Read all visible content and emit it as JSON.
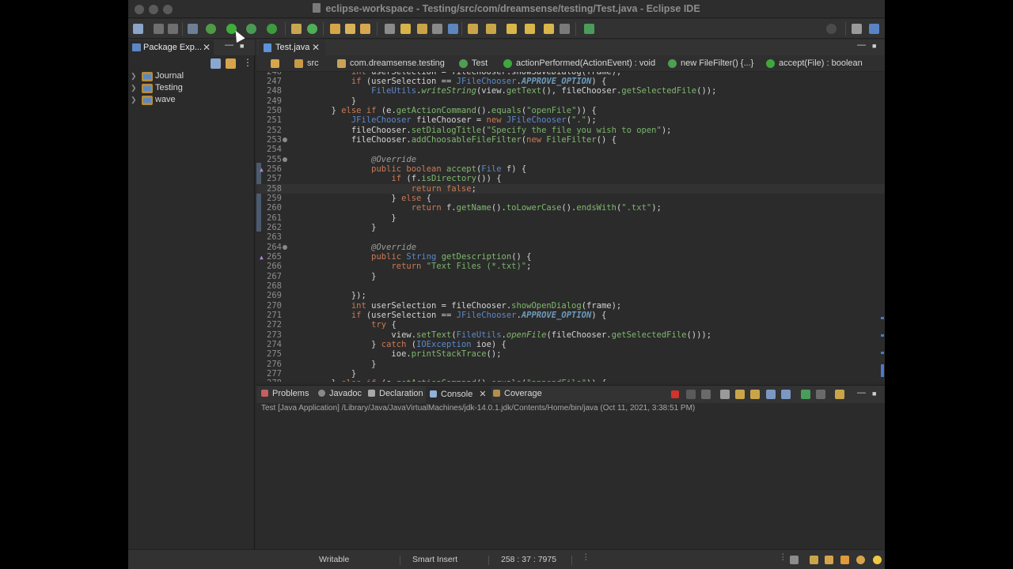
{
  "window": {
    "title": "eclipse-workspace - Testing/src/com/dreamsense/testing/Test.java - Eclipse IDE"
  },
  "colors": {
    "keyword": "#cc7a54",
    "type": "#5c89c9",
    "string": "#79b36b",
    "method": "#7fb86f",
    "field": "#6d9cbe",
    "annotation": "#9d9d9d",
    "background": "#2b2b2b"
  },
  "toolbar": {
    "icons": [
      "new-icon",
      "save-icon",
      "save-all-icon",
      "skip-breakpoints-icon",
      "debug-icon",
      "run-icon",
      "coverage-icon",
      "external-tools-icon",
      "new-java-project-icon",
      "new-package-icon",
      "new-class-icon",
      "open-type-icon",
      "search-icon",
      "perspective-java-icon",
      "perspective-debug-icon"
    ]
  },
  "package_explorer": {
    "tab_label": "Package Exp...",
    "projects": [
      {
        "name": "Journal"
      },
      {
        "name": "Testing"
      },
      {
        "name": "wave"
      }
    ]
  },
  "editor": {
    "tab_label": "Test.java",
    "breadcrumb": [
      "src",
      "com.dreamsense.testing",
      "Test",
      "actionPerformed(ActionEvent) : void",
      "new FileFilter() {...}",
      "accept(File) : boolean"
    ],
    "current_line": "258"
  },
  "console": {
    "tabs": [
      {
        "label": "Problems"
      },
      {
        "label": "Javadoc"
      },
      {
        "label": "Declaration"
      },
      {
        "label": "Console"
      },
      {
        "label": "Coverage"
      }
    ],
    "description": "Test [Java Application] /Library/Java/JavaVirtualMachines/jdk-14.0.1.jdk/Contents/Home/bin/java  (Oct 11, 2021, 3:38:51 PM)"
  },
  "status": {
    "writable": "Writable",
    "insert_mode": "Smart Insert",
    "position": "258 : 37 : 7975"
  }
}
